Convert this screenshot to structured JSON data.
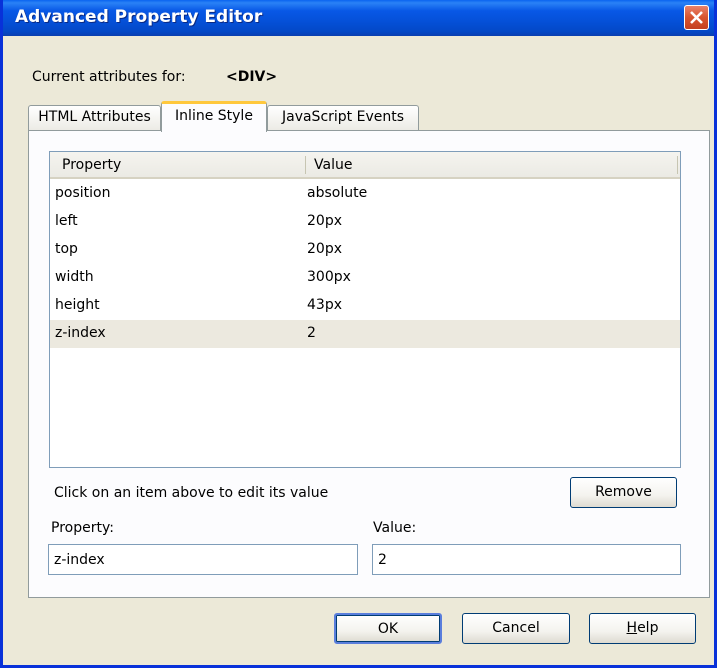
{
  "window": {
    "title": "Advanced Property Editor"
  },
  "header": {
    "current_label": "Current attributes for:",
    "tag": "<DIV>"
  },
  "tabs": [
    {
      "label": "HTML Attributes",
      "active": false
    },
    {
      "label": "Inline Style",
      "active": true
    },
    {
      "label": "JavaScript Events",
      "active": false
    }
  ],
  "grid": {
    "columns": [
      "Property",
      "Value"
    ],
    "rows": [
      {
        "property": "position",
        "value": "absolute"
      },
      {
        "property": "left",
        "value": "20px"
      },
      {
        "property": "top",
        "value": "20px"
      },
      {
        "property": "width",
        "value": "300px"
      },
      {
        "property": "height",
        "value": "43px"
      },
      {
        "property": "z-index",
        "value": "2",
        "selected": true
      }
    ]
  },
  "editor": {
    "hint": "Click on an item above to edit its value",
    "remove_label": "Remove",
    "property_label": "Property:",
    "property_value": "z-index",
    "value_label": "Value:",
    "value_value": "2"
  },
  "buttons": {
    "ok": "OK",
    "cancel": "Cancel",
    "help_first": "H",
    "help_rest": "elp"
  },
  "colors": {
    "titlebar": "#0054e3",
    "selection": "#ece9df",
    "active_tab_accent": "#ffc83c",
    "close": "#d8542e"
  }
}
